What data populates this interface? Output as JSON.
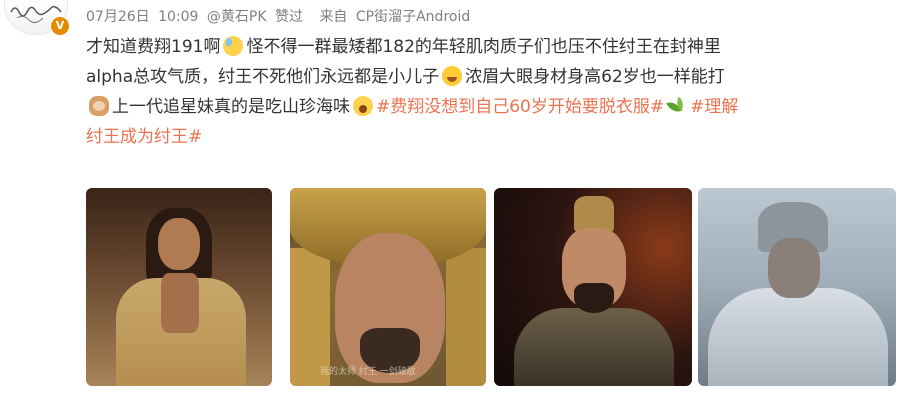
{
  "header": {
    "avatar_badge": "V",
    "date": "07月26日",
    "time": "10:09",
    "repost_from": "@黄石PK",
    "repost_action": "赞过",
    "source_prefix": "来自",
    "source": "CP街溜子Android"
  },
  "post": {
    "line1_text_a": "才知道费翔191啊",
    "line1_emoji": "sweat-smile-emoji",
    "line1_text_b": "怪不得一群最矮都182的年轻肌肉质子们也压不住纣王在封神里",
    "line2_text_a": "alpha总攻气质，纣王不死他们永远都是小儿子",
    "line2_emoji": "laugh-emoji",
    "line2_text_b": "浓眉大眼身材身高62岁也一样能打",
    "line3_emoji_a": "monkey-emoji",
    "line3_text_a": "上一代追星妹真的是吃山珍海味",
    "line3_emoji_b": "yawn-emoji",
    "line3_tag_1": "#费翔没想到自己60岁开始要脱衣服#",
    "line3_emoji_c": "leaf-emoji",
    "line3_tag_2_part1": "#理解",
    "line4_tag_2_part2": "纣王成为纣王#"
  },
  "photos": [
    {
      "name": "photo-1",
      "alt": "Long-haired man in open tan robe"
    },
    {
      "name": "photo-2",
      "alt": "Close-up of bearded man in golden helmet",
      "subtitle": "我的太师 纣王 一剑破敌"
    },
    {
      "name": "photo-3",
      "alt": "Crowned man with beard in dark armor"
    },
    {
      "name": "photo-4",
      "alt": "Warrior in snow-covered armor"
    }
  ],
  "colors": {
    "tag": "#eb7350",
    "meta": "#808080",
    "badge": "#e68a00"
  }
}
